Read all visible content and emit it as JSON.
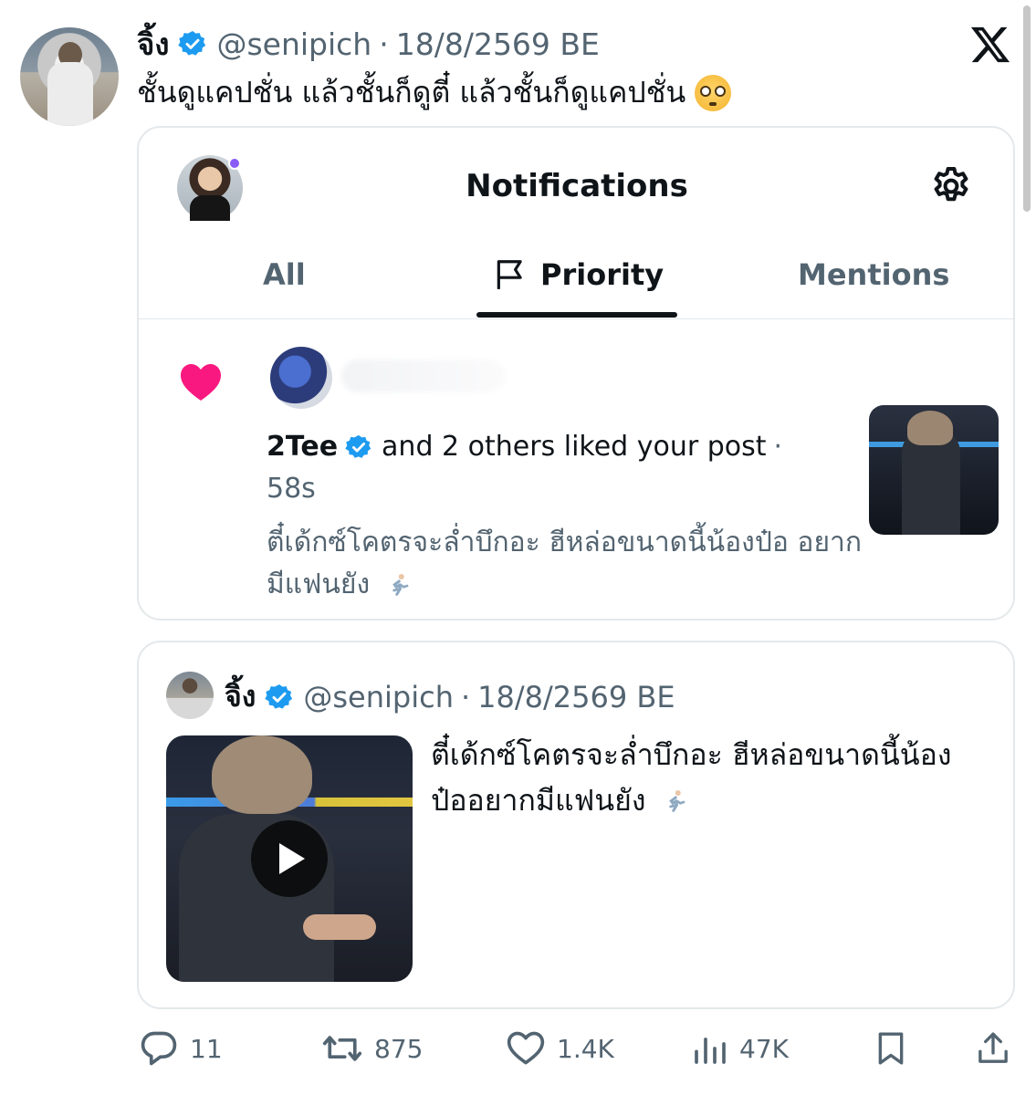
{
  "post": {
    "author_name": "จิ้ง",
    "handle": "@senipich",
    "separator": "·",
    "date": "18/8/2569 BE",
    "text": "ชั้นดูแคปชั่น แล้วชั้นก็ดูตี๋ แล้วชั้นก็ดูแคปชั่น",
    "emoji": "flushed-face"
  },
  "notifications": {
    "title": "Notifications",
    "tabs": [
      {
        "label": "All",
        "active": false
      },
      {
        "label": "Priority",
        "active": true
      },
      {
        "label": "Mentions",
        "active": false
      }
    ],
    "item": {
      "user": "2Tee",
      "action": "and 2 others liked your post",
      "separator": "·",
      "time": "58s",
      "snippet": "ตี๋เด้กซ์โคตรจะล่ำบึกอะ ฮีหล่อขนาดนี้น้องป๋อ อยากมีแฟนยัง"
    }
  },
  "quoted": {
    "author_name": "จิ้ง",
    "handle": "@senipich",
    "separator": "·",
    "date": "18/8/2569 BE",
    "text": "ตี๋เด้กซ์โคตรจะล่ำบึกอะ ฮีหล่อขนาดนี้น้อง ป๋ออยากมีแฟนยัง"
  },
  "actions": {
    "replies": "11",
    "reposts": "875",
    "likes": "1.4K",
    "views": "47K"
  },
  "colors": {
    "verified": "#1d9bf0",
    "heart": "#f91880",
    "muted": "#536471",
    "border": "#e4e8eb",
    "online_dot": "#8a5cf6"
  }
}
